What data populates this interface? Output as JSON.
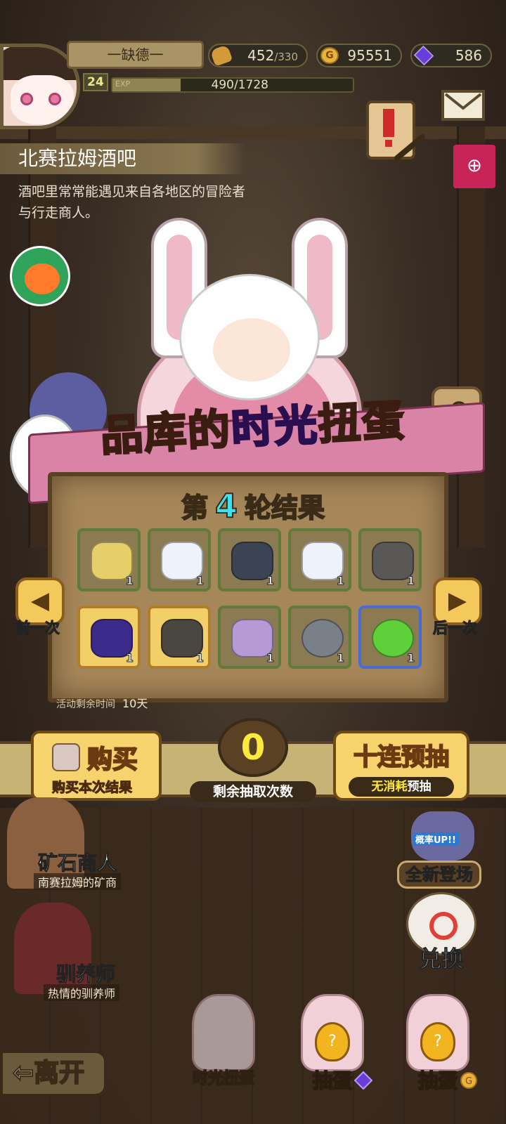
{
  "player": {
    "name": "一缺德一",
    "level": "24",
    "exp_label": "EXP",
    "exp_text": "490/1728",
    "exp_fraction": 0.283
  },
  "resources": {
    "stamina": "452",
    "stamina_max": "/330",
    "gold": "95551",
    "gems": "586"
  },
  "location": {
    "title": "北赛拉姆酒吧",
    "description": "酒吧里常常能遇见来自各地区的冒险者与行走商人。"
  },
  "banner": {
    "part1": "品库的",
    "highlight": "时光",
    "part2": "扭蛋"
  },
  "results": {
    "prefix": "第",
    "round": "4",
    "suffix": "轮结果",
    "items": [
      {
        "icon": "gold-ore-icon",
        "count": "1",
        "rarity": "normal"
      },
      {
        "icon": "cotton-planet-icon",
        "count": "1",
        "rarity": "normal"
      },
      {
        "icon": "dark-shell-icon",
        "count": "1",
        "rarity": "normal"
      },
      {
        "icon": "cotton-planet-icon",
        "count": "1",
        "rarity": "normal"
      },
      {
        "icon": "iron-ore-icon",
        "count": "1",
        "rarity": "normal"
      },
      {
        "icon": "purple-crystal-ore-icon",
        "count": "1",
        "rarity": "gold"
      },
      {
        "icon": "spiky-seed-icon",
        "count": "1",
        "rarity": "gold"
      },
      {
        "icon": "lavender-bulb-icon",
        "count": "1",
        "rarity": "normal"
      },
      {
        "icon": "spiral-stone-icon",
        "count": "1",
        "rarity": "normal"
      },
      {
        "icon": "green-slime-egg-icon",
        "count": "1",
        "rarity": "blue"
      }
    ],
    "prev_label": "前一次",
    "next_label": "后一次",
    "time_left_label": "活动剩余时间",
    "time_left_value": "10天"
  },
  "actions": {
    "buy_title": "购买",
    "buy_sub": "购买本次结果",
    "remaining_count": "0",
    "remaining_label": "剩余抽取次数",
    "ten_title": "十连预抽",
    "ten_sub_highlight": "无消耗",
    "ten_sub_rest": "预抽"
  },
  "npcs": [
    {
      "name": "矿石商人",
      "subtitle": "南赛拉姆的矿商"
    },
    {
      "name": "驯养师",
      "subtitle": "热情的驯养师"
    }
  ],
  "side_buttons": {
    "new_tag": "概率UP!!",
    "new_label": "全新登场",
    "exchange_label": "兑换"
  },
  "bottom": {
    "leave": "⇦离开",
    "time_gacha": "时光扭蛋",
    "draw_gem": "抽蛋",
    "draw_gold": "抽蛋"
  },
  "colors": {
    "accent_cyan": "#3fe0f0",
    "gold_button": "#f6d36c",
    "remaining_yellow": "#ffe93a",
    "zoom_button": "#c8245a"
  }
}
